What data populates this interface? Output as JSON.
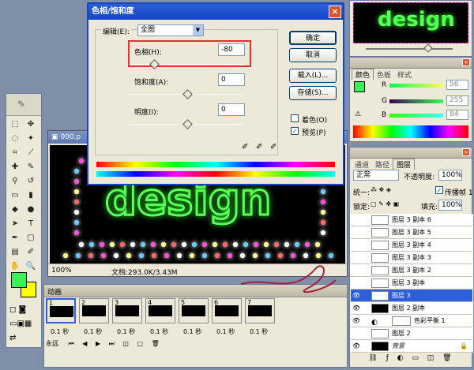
{
  "dialog": {
    "title": "色相/饱和度",
    "edit_label": "编辑(E):",
    "edit_value": "全图",
    "hue_label": "色相(H):",
    "hue_value": "-80",
    "saturation_label": "饱和度(A):",
    "saturation_value": "0",
    "lightness_label": "明度(I):",
    "lightness_value": "0",
    "ok": "确定",
    "cancel": "取消",
    "load": "载入(L)...",
    "save": "存储(S)...",
    "colorize": "着色(O)",
    "preview": "预览(P)"
  },
  "document": {
    "title": "000.p",
    "zoom": "100%",
    "doc_info": "文档:293.0K/3.43M",
    "artwork_text": "design"
  },
  "color_panel": {
    "tabs": [
      "颜色",
      "色板",
      "样式"
    ],
    "r_label": "R",
    "r_value": "56",
    "g_label": "G",
    "g_value": "255",
    "b_label": "B",
    "b_value": "84"
  },
  "layers_panel": {
    "tabs": [
      "通道",
      "路径",
      "图层"
    ],
    "blend_mode": "正常",
    "opacity_label": "不透明度:",
    "opacity_value": "100%",
    "unify_label": "统一:",
    "propagate_label": "传播帧 1",
    "lock_label": "锁定:",
    "fill_label": "填充:",
    "fill_value": "100%",
    "layers": [
      {
        "name": "图层 3 副本 6"
      },
      {
        "name": "图层 3 副本 5"
      },
      {
        "name": "图层 3 副本 4"
      },
      {
        "name": "图层 3 副本 3"
      },
      {
        "name": "图层 3 副本 2"
      },
      {
        "name": "图层 3 副本"
      },
      {
        "name": "图层 3"
      },
      {
        "name": "图层 2 副本"
      },
      {
        "name": "色彩平衡 1"
      },
      {
        "name": "图层 2"
      },
      {
        "name": "背景"
      }
    ]
  },
  "animation_panel": {
    "title": "动画",
    "loop": "永远",
    "frames": [
      {
        "num": "1",
        "time": "0.1 秒"
      },
      {
        "num": "2",
        "time": "0.1 秒"
      },
      {
        "num": "3",
        "time": "0.1 秒"
      },
      {
        "num": "4",
        "time": "0.1 秒"
      },
      {
        "num": "5",
        "time": "0.1 秒"
      },
      {
        "num": "6",
        "time": "0.1 秒"
      },
      {
        "num": "7",
        "time": "0.1 秒"
      }
    ]
  },
  "navigator": {
    "text": "design"
  },
  "colors": {
    "accent_green": "#3cff56",
    "foreground": "#39f554",
    "background": "#ffff00",
    "selection_blue": "#2c5fd9"
  }
}
